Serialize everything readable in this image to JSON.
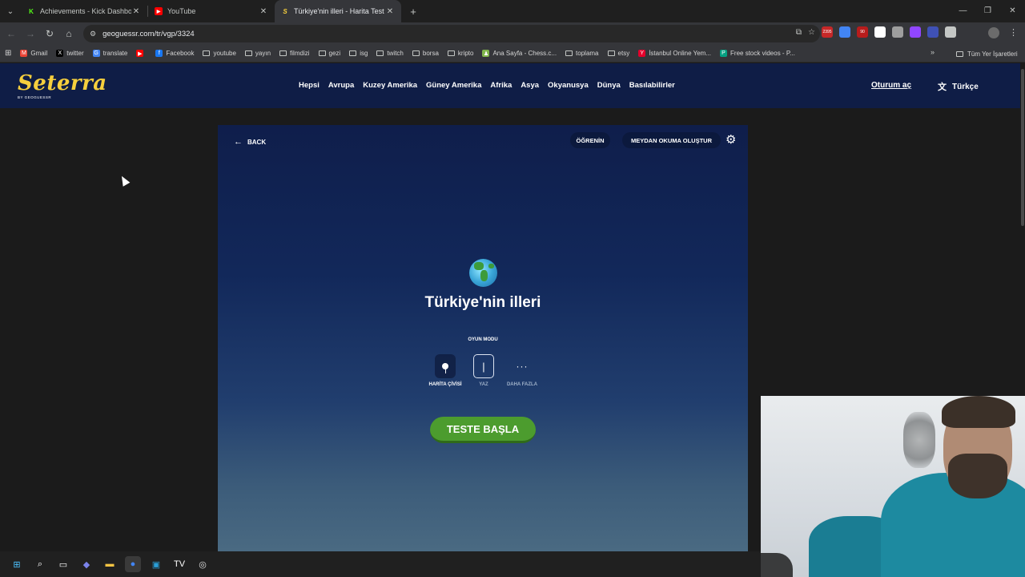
{
  "browser": {
    "tabs": [
      {
        "title": "Achievements - Kick Dashboard",
        "icon": "kick-icon",
        "color": "#53fc18",
        "glyph": "K",
        "active": false
      },
      {
        "title": "YouTube",
        "icon": "youtube-icon",
        "color": "#ff0000",
        "glyph": "▶",
        "active": false
      },
      {
        "title": "Türkiye'nin illeri - Harita Test O",
        "icon": "seterra-icon",
        "color": "#f6cf3d",
        "glyph": "S",
        "active": true
      }
    ],
    "tab_close": "✕",
    "new_tab": "+",
    "window_controls": [
      "—",
      "❐",
      "✕"
    ],
    "url": "geoguessr.com/tr/vgp/3324",
    "bookmarks": [
      {
        "label": "Gmail",
        "type": "site",
        "color": "#ea4335",
        "glyph": "M"
      },
      {
        "label": "twitter",
        "type": "site",
        "color": "#000000",
        "glyph": "X"
      },
      {
        "label": "translate",
        "type": "site",
        "color": "#4285f4",
        "glyph": "G"
      },
      {
        "label": "",
        "type": "site",
        "color": "#ff0000",
        "glyph": "▶"
      },
      {
        "label": "Facebook",
        "type": "site",
        "color": "#1877f2",
        "glyph": "f"
      },
      {
        "label": "youtube",
        "type": "folder"
      },
      {
        "label": "yayın",
        "type": "folder"
      },
      {
        "label": "filmdizi",
        "type": "folder"
      },
      {
        "label": "gezi",
        "type": "folder"
      },
      {
        "label": "isg",
        "type": "folder"
      },
      {
        "label": "twitch",
        "type": "folder"
      },
      {
        "label": "borsa",
        "type": "folder"
      },
      {
        "label": "kripto",
        "type": "folder"
      },
      {
        "label": "Ana Sayfa - Chess.c...",
        "type": "site",
        "color": "#81b64c",
        "glyph": "♟"
      },
      {
        "label": "toplama",
        "type": "folder"
      },
      {
        "label": "etsy",
        "type": "folder"
      },
      {
        "label": "İstanbul Online Yem...",
        "type": "site",
        "color": "#e4002b",
        "glyph": "Y"
      },
      {
        "label": "Free stock videos - P...",
        "type": "site",
        "color": "#05a081",
        "glyph": "P"
      }
    ],
    "bookmarks_more": "»",
    "all_bookmarks": "Tüm Yer İşaretleri",
    "extensions": [
      {
        "name": "extension-badge-icon",
        "color": "#c62828",
        "badge": "2395"
      },
      {
        "name": "translate-extension-icon",
        "color": "#4285f4",
        "badge": ""
      },
      {
        "name": "extension-badge-icon",
        "color": "#b71c1c",
        "badge": "90"
      },
      {
        "name": "diamond-extension-icon",
        "color": "#ffffff",
        "badge": ""
      },
      {
        "name": "glasses-extension-icon",
        "color": "#9e9e9e",
        "badge": ""
      },
      {
        "name": "twitch-extension-icon",
        "color": "#9146ff",
        "badge": ""
      },
      {
        "name": "speak-extension-icon",
        "color": "#3f51b5",
        "badge": ""
      },
      {
        "name": "puzzle-extensions-icon",
        "color": "#c4c7c5",
        "badge": ""
      }
    ]
  },
  "site": {
    "logo": "Seterra",
    "logo_sub": "BY GEOGUESSR",
    "nav": [
      "Hepsi",
      "Avrupa",
      "Kuzey Amerika",
      "Güney Amerika",
      "Afrika",
      "Asya",
      "Okyanusya",
      "Dünya",
      "Basılabilirler"
    ],
    "login": "Oturum aç",
    "language": "Türkçe"
  },
  "quiz": {
    "back": "BACK",
    "learn": "ÖĞRENİN",
    "challenge": "MEYDAN OKUMA OLUŞTUR",
    "title": "Türkiye'nin illeri",
    "mode_label": "OYUN MODU",
    "modes": [
      {
        "label": "HARİTA ÇİVİSİ",
        "selected": true
      },
      {
        "label": "YAZ",
        "selected": false
      },
      {
        "label": "DAHA FAZLA",
        "selected": false
      }
    ],
    "start": "TESTE BAŞLA"
  },
  "taskbar": [
    {
      "name": "windows-start-icon",
      "glyph": "⊞",
      "color": "#4cc2ff"
    },
    {
      "name": "search-icon",
      "glyph": "⌕",
      "color": "#ffffff"
    },
    {
      "name": "task-view-icon",
      "glyph": "▭",
      "color": "#ffffff"
    },
    {
      "name": "copilot-icon",
      "glyph": "◆",
      "color": "#7b83eb"
    },
    {
      "name": "file-explorer-icon",
      "glyph": "▬",
      "color": "#f6c443"
    },
    {
      "name": "chrome-icon",
      "glyph": "●",
      "color": "#4285f4"
    },
    {
      "name": "app-icon",
      "glyph": "▣",
      "color": "#2a9fd8"
    },
    {
      "name": "tradingview-icon",
      "glyph": "TV",
      "color": "#ffffff"
    },
    {
      "name": "streaming-app-icon",
      "glyph": "◎",
      "color": "#e0e0e0"
    }
  ]
}
